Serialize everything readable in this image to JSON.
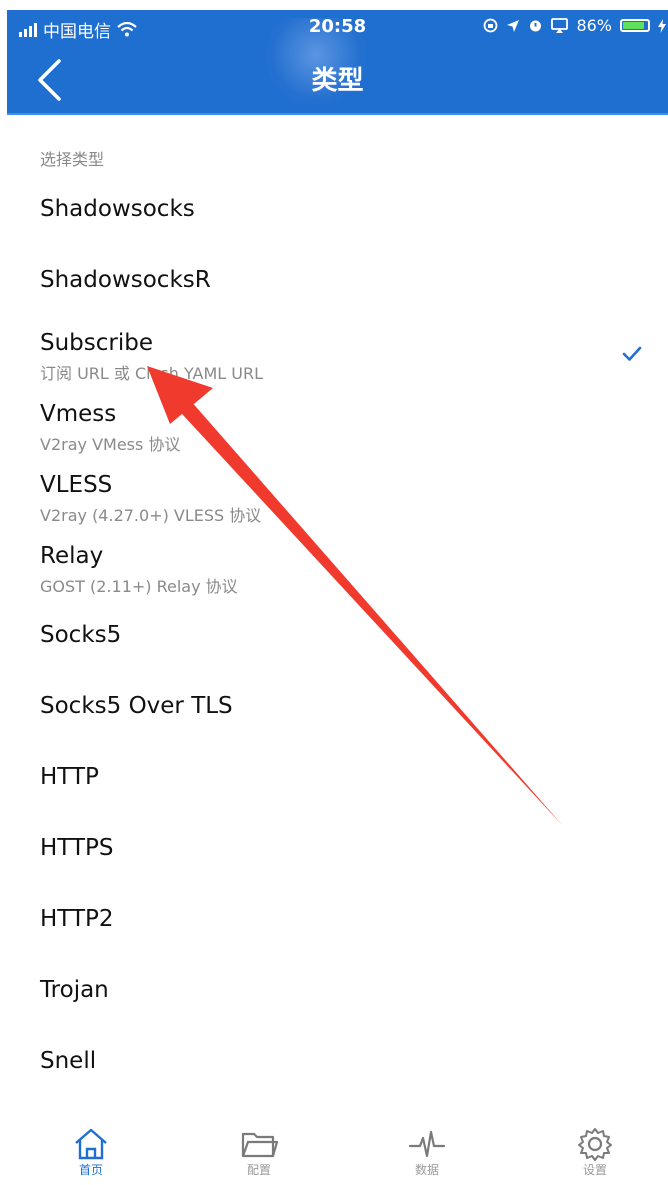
{
  "status_bar": {
    "carrier": "中国电信",
    "time": "20:58",
    "battery_percent": "86%",
    "battery_level": 0.86
  },
  "header": {
    "title": "类型",
    "back_icon": "chevron-left-icon"
  },
  "section_label": "选择类型",
  "selected_index": 2,
  "types": [
    {
      "title": "Shadowsocks",
      "subtitle": ""
    },
    {
      "title": "ShadowsocksR",
      "subtitle": ""
    },
    {
      "title": "Subscribe",
      "subtitle": "订阅 URL 或 Clash YAML URL"
    },
    {
      "title": "Vmess",
      "subtitle": "V2ray VMess 协议"
    },
    {
      "title": "VLESS",
      "subtitle": "V2ray (4.27.0+) VLESS 协议"
    },
    {
      "title": "Relay",
      "subtitle": "GOST (2.11+) Relay 协议"
    },
    {
      "title": "Socks5",
      "subtitle": ""
    },
    {
      "title": "Socks5 Over TLS",
      "subtitle": ""
    },
    {
      "title": "HTTP",
      "subtitle": ""
    },
    {
      "title": "HTTPS",
      "subtitle": ""
    },
    {
      "title": "HTTP2",
      "subtitle": ""
    },
    {
      "title": "Trojan",
      "subtitle": ""
    },
    {
      "title": "Snell",
      "subtitle": ""
    }
  ],
  "tabs": [
    {
      "label": "首页",
      "icon": "home-icon",
      "active": true
    },
    {
      "label": "配置",
      "icon": "folder-icon",
      "active": false
    },
    {
      "label": "数据",
      "icon": "pulse-icon",
      "active": false
    },
    {
      "label": "设置",
      "icon": "gear-icon",
      "active": false
    }
  ],
  "colors": {
    "header_bg": "#1f6fd0",
    "accent": "#1f6fd0",
    "check": "#1f6fd0",
    "annotation_arrow": "#f03a2e"
  }
}
